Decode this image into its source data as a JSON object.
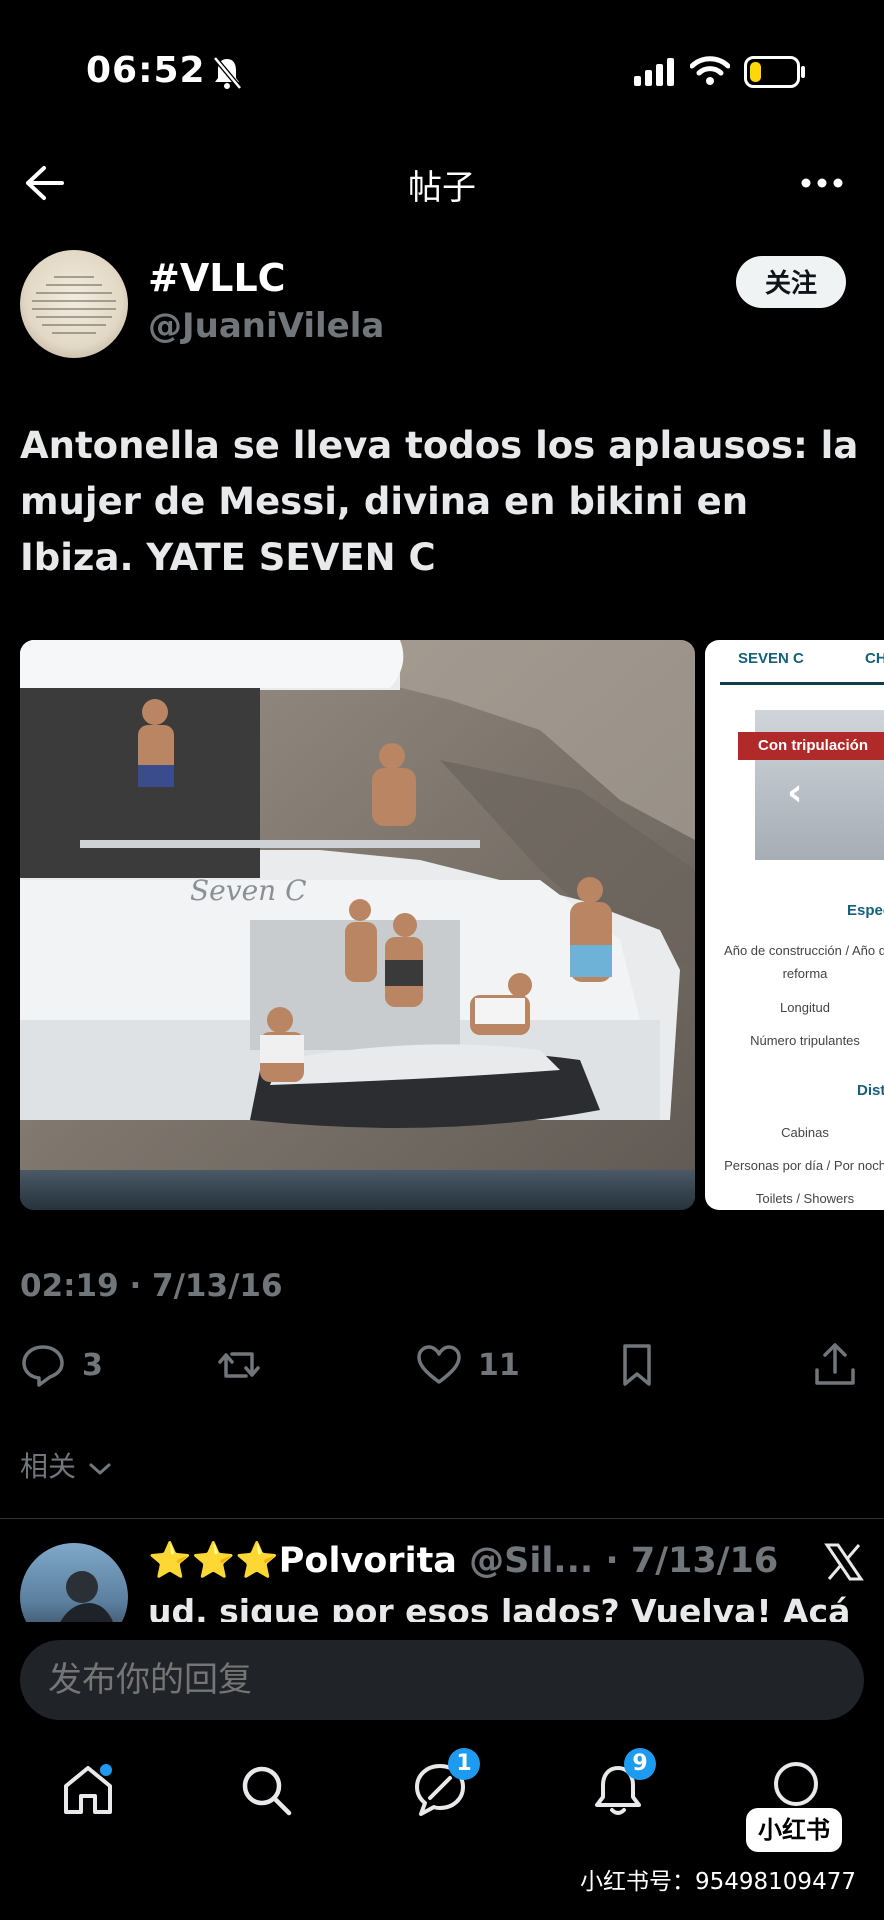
{
  "status_bar": {
    "time": "06:52",
    "battery_level": 0.25
  },
  "header": {
    "title": "帖子"
  },
  "author": {
    "display_name": "#VLLC",
    "handle": "@JuaniVilela",
    "follow_label": "关注"
  },
  "post": {
    "text": "Antonella se lleva todos los aplausos: la mujer de Messi, divina en bikini en Ibiza. YATE SEVEN C",
    "timestamp": "02:19 · 7/13/16"
  },
  "media": {
    "second_image": {
      "tab1": "SEVEN C",
      "tab2": "CH",
      "banner": "Con tripulación",
      "section1": "Espec",
      "rows1": [
        "Año de construcción / Año d",
        "reforma",
        "Longitud",
        "Número tripulantes"
      ],
      "section2": "Dist",
      "rows2": [
        "Cabinas",
        "Personas por día / Por noch",
        "Toilets / Showers"
      ]
    },
    "first_image": {
      "boat_name": "Seven C"
    }
  },
  "actions": {
    "reply_count": "3",
    "like_count": "11"
  },
  "related": {
    "label": "相关"
  },
  "reply_preview": {
    "stars": "⭐⭐⭐",
    "name": "Polvorita",
    "meta": "@Sil... · 7/13/16",
    "text": "ud. sigue por esos lados? Vuelva! Acá"
  },
  "composer": {
    "placeholder": "发布你的回复"
  },
  "nav": {
    "messages_badge": "1",
    "notifications_badge": "9"
  },
  "watermark": {
    "badge": "小红书",
    "text": "小红书号：95498109477"
  }
}
